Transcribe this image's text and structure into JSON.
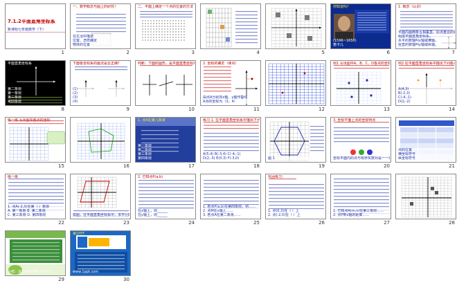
{
  "view": "slide-sorter",
  "slides": [
    {
      "number": "1",
      "title": "7.1.2平面直角坐标系",
      "text": [
        "新课标七年级数学（下）"
      ]
    },
    {
      "number": "2",
      "title": "一、数学概念与图上的研究！",
      "text": [
        "在生活中描述",
        "位置、怎样确定",
        "物体的位置"
      ]
    },
    {
      "number": "3",
      "title": "二、平面上确定一个点的位置的方法",
      "text": []
    },
    {
      "number": "4",
      "title": "",
      "text": []
    },
    {
      "number": "5",
      "title": "",
      "text": []
    },
    {
      "number": "6",
      "title": "你知道吗？",
      "text": [
        "(1596~1650)",
        "笛卡儿"
      ]
    },
    {
      "number": "7",
      "title": "1. 概念（认识）",
      "text": [
        "平面内画两条互相垂直、原点重合的数轴，",
        "组成平面直角坐标系。",
        "水平的数轴叫x轴或横轴，",
        "竖直的数轴叫y轴或纵轴。"
      ]
    },
    {
      "number": "8",
      "title": "平面直角坐标系",
      "text": [
        "第二象限",
        "第一象限",
        "第三象限",
        "第四象限"
      ]
    },
    {
      "number": "9",
      "title": "下面各坐标系的画法是否正确？",
      "text": [
        "(1)",
        "(2)",
        "(3)",
        "(4)"
      ]
    },
    {
      "number": "10",
      "title": "判断：下面的图形，是平面直角坐标系的是（ ）",
      "text": []
    },
    {
      "number": "11",
      "title": "2. 坐标的确定（读点）",
      "text": [
        "由点A分别向x轴、y轴作垂线",
        "A点的坐标为（3，4）"
      ]
    },
    {
      "number": "12",
      "title": "",
      "text": []
    },
    {
      "number": "13",
      "title": "例1 写出图中A、B、C、D各点的坐标",
      "text": []
    },
    {
      "number": "14",
      "title": "例2 在平面直角坐标系中描出下列各点",
      "text": [
        "A(4,3)",
        "B(-2,3)",
        "C(-4,-1)",
        "D(2,-2)"
      ]
    },
    {
      "number": "15",
      "title": "练一练 写出图中各点的坐标",
      "text": []
    },
    {
      "number": "16",
      "title": "",
      "text": []
    },
    {
      "number": "17",
      "title": "1. 点A在第几象限",
      "text": [
        "第一象限",
        "第二象限",
        "第三象限",
        "第四象限"
      ]
    },
    {
      "number": "18",
      "title": "练习 1. 在平面直角坐标系中描出下列各点",
      "text": [
        "A(5,4) B(-3,4) C(-4,-1)",
        "D(2,-3) E(0,3) F(-3,0)"
      ]
    },
    {
      "number": "19",
      "title": "",
      "text": [
        "图 1"
      ]
    },
    {
      "number": "20",
      "title": "3. 坐标平面上点的坐标特点",
      "text": [
        "坐标平面内的点与有序实数对是一一对应的"
      ]
    },
    {
      "number": "21",
      "title": "",
      "text": [
        "点的位置",
        "横坐标符号",
        "纵坐标符号"
      ]
    },
    {
      "number": "22",
      "title": "练一练",
      "text": [
        "1. 点A(-2,3)在第（ ）象限",
        "A. 第一象限  B. 第二象限",
        "C. 第三象限  D. 第四象限"
      ]
    },
    {
      "number": "23",
      "title": "",
      "text": [
        "如图，在平面直角坐标系中，求平行四边形的顶点坐标"
      ]
    },
    {
      "number": "24",
      "title": "2. 已知点P(a,b)",
      "text": [
        "在x轴上，则______",
        "在y轴上，则______"
      ]
    },
    {
      "number": "25",
      "title": "",
      "text": [
        "1. 若点P(a,b)在第四象限，则……",
        "2. 点M在x轴上……",
        "3. 若点A在第二象限……"
      ]
    },
    {
      "number": "26",
      "title": "巩固练习：",
      "text": [
        "1. 点(0,3)在（ ）上",
        "2. 点(-2,0)在（ ）上"
      ]
    },
    {
      "number": "27",
      "title": "",
      "text": [
        "1. 已知点A(m,n)在第三象限……",
        "2. 点P到x轴的距离……"
      ]
    },
    {
      "number": "28",
      "title": "",
      "text": []
    },
    {
      "number": "29",
      "title": "",
      "text": [
        "小结：这节课你学到了什么？"
      ]
    },
    {
      "number": "30",
      "title": "第1PPT",
      "text": [
        "www.1ppt.com"
      ]
    }
  ],
  "colors": {
    "thumb_border": "#8a8a8a",
    "title_red": "#c00000",
    "slide6_bg": "#0d2b8e",
    "slide8_bg": "#000000",
    "slide30_bg": "#1c68c4",
    "grid_blue": "#1f3fd6",
    "text_blue": "#1d2fa6"
  }
}
